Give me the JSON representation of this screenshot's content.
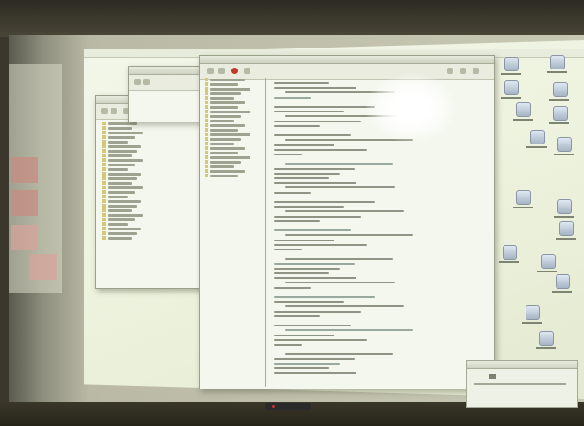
{
  "scene": {
    "description_visible_text": ""
  },
  "colors": {
    "wall": "#3b372c",
    "projection": "#eef3df",
    "window": "#f4f7ee",
    "stop": "#c0392b",
    "glare": "#ffffff"
  },
  "icons": [
    "stop-icon",
    "folder-icon",
    "document-icon",
    "disk-icon"
  ]
}
